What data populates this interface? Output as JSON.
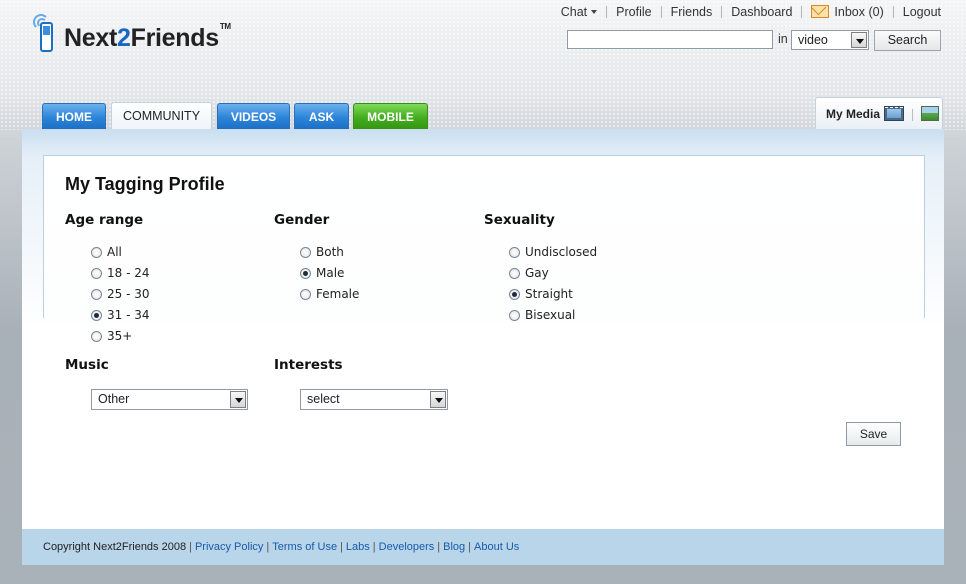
{
  "brand": {
    "name_part1": "Next",
    "name_part2": "2",
    "name_part3": "Friends",
    "tm": "TM"
  },
  "topnav": {
    "chat": "Chat",
    "profile": "Profile",
    "friends": "Friends",
    "dashboard": "Dashboard",
    "inbox": "Inbox (0)",
    "logout": "Logout"
  },
  "search": {
    "value": "",
    "in_label": "in",
    "type": "video",
    "button": "Search"
  },
  "tabs": [
    {
      "label": "HOME"
    },
    {
      "label": "COMMUNITY",
      "active": true
    },
    {
      "label": "VIDEOS"
    },
    {
      "label": "ASK"
    },
    {
      "label": "MOBILE"
    }
  ],
  "my_media": {
    "label": "My Media",
    "icons": [
      "film-icon",
      "photo-icon"
    ]
  },
  "profile": {
    "title": "My Tagging Profile",
    "age_range": {
      "label": "Age range",
      "options": [
        "All",
        "18 - 24",
        "25 - 30",
        "31 - 34",
        "35+"
      ],
      "selected": "31 - 34"
    },
    "gender": {
      "label": "Gender",
      "options": [
        "Both",
        "Male",
        "Female"
      ],
      "selected": "Male"
    },
    "sexuality": {
      "label": "Sexuality",
      "options": [
        "Undisclosed",
        "Gay",
        "Straight",
        "Bisexual"
      ],
      "selected": "Straight"
    },
    "music": {
      "label": "Music",
      "value": "Other"
    },
    "interests": {
      "label": "Interests",
      "value": "select"
    },
    "save": "Save"
  },
  "footer": {
    "copyright": "Copyright Next2Friends 2008",
    "links": [
      "Privacy Policy",
      "Terms of Use",
      "Labs",
      "Developers",
      "Blog",
      "About Us"
    ]
  }
}
